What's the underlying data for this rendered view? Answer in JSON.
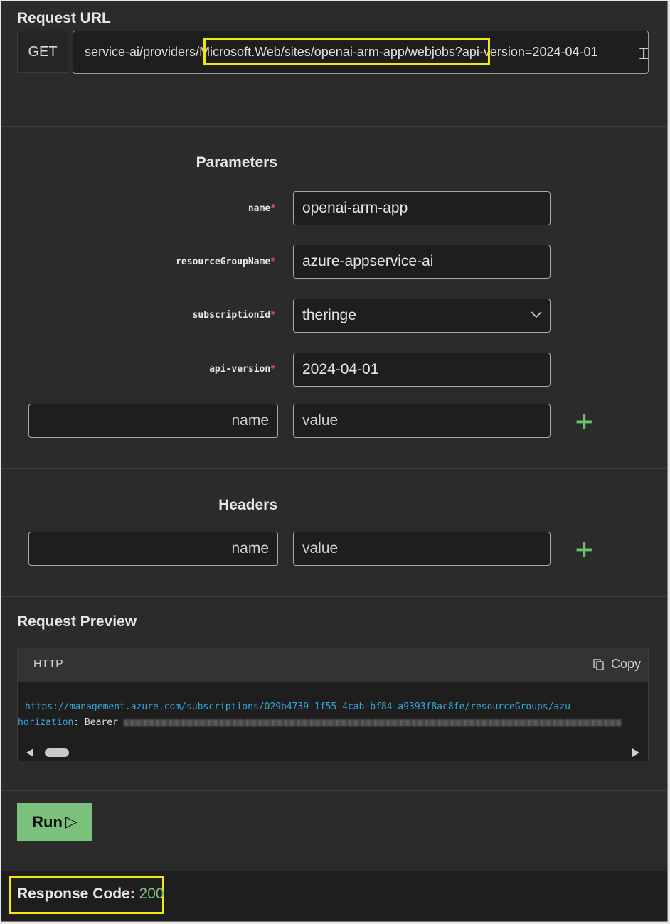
{
  "request_url": {
    "title": "Request URL",
    "method": "GET",
    "url_prefix": "service-ai/providers",
    "url_highlight": "/Microsoft.Web/sites/openai-arm-app/webjobs",
    "url_suffix": "?api-version=2024-04-01"
  },
  "parameters": {
    "title": "Parameters",
    "items": [
      {
        "label": "name",
        "value": "openai-arm-app"
      },
      {
        "label": "resourceGroupName",
        "value": "azure-appservice-ai"
      },
      {
        "label": "subscriptionId",
        "value": "theringe"
      },
      {
        "label": "api-version",
        "value": "2024-04-01"
      }
    ],
    "required_marker": "*",
    "new_name_placeholder": "name",
    "new_value_placeholder": "value",
    "add_symbol": "+"
  },
  "headers": {
    "title": "Headers",
    "new_name_placeholder": "name",
    "new_value_placeholder": "value",
    "add_symbol": "+"
  },
  "request_preview": {
    "title": "Request Preview",
    "language": "HTTP",
    "copy_label": "Copy",
    "line1": "https://management.azure.com/subscriptions/029b4739-1f55-4cab-bf84-a9393f8ac8fe/resourceGroups/azu",
    "line2_key": "horization",
    "line2_sep": ": Bearer"
  },
  "run": {
    "label": "Run",
    "icon": "▷"
  },
  "response": {
    "label": "Response Code:",
    "code": "200"
  }
}
